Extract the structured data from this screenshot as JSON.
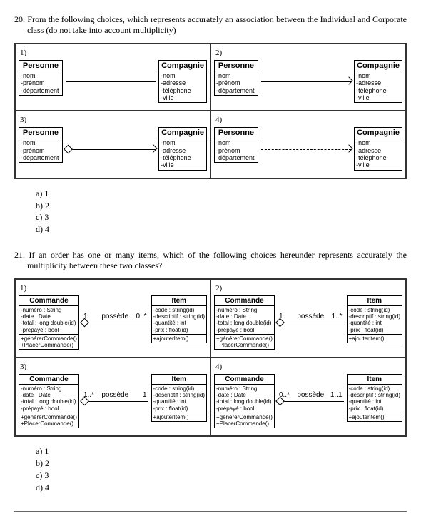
{
  "q20": {
    "number": "20.",
    "text": "From the following choices, which represents accurately an association between the Individual and Corporate class (do not take into account multiplicity)",
    "cells": [
      "1)",
      "2)",
      "3)",
      "4)"
    ],
    "personne": {
      "name": "Personne",
      "a1": "nom",
      "a2": "prénom",
      "a3": "département"
    },
    "compagnie": {
      "name": "Compagnie",
      "a1": "nom",
      "a2": "adresse",
      "a3": "téléphone",
      "a4": "ville"
    },
    "answers": {
      "a": "a)  1",
      "b": "b)  2",
      "c": "c)  3",
      "d": "d)  4"
    }
  },
  "q21": {
    "number": "21.",
    "text": "If an order has one or many items, which of the following choices hereunder represents accurately the multiplicity between these two classes?",
    "cells": [
      "1)",
      "2)",
      "3)",
      "4)"
    ],
    "commande": {
      "name": "Commande",
      "a1": "numéro : String",
      "a2": "date : Date",
      "a3": "total : long double(id)",
      "a4": "prépayé : bool",
      "o1": "générerCommande()",
      "o2": "PlacerCommande()"
    },
    "item": {
      "name": "Item",
      "a1": "code : string(id)",
      "a2": "descriptif : string(id)",
      "a3": "quantité : int",
      "a4": "prix : float(id)",
      "o1": "ajouterItem()"
    },
    "assoc_label": "possède",
    "mult": {
      "c1l": "1",
      "c1r": "0..*",
      "c2l": "1",
      "c2r": "1..*",
      "c3l": "1..*",
      "c3r": "1",
      "c4l": "0..*",
      "c4r": "1..1"
    },
    "answers": {
      "a": "a)  1",
      "b": "b)  2",
      "c": "c)  3",
      "d": "d)  4"
    }
  }
}
